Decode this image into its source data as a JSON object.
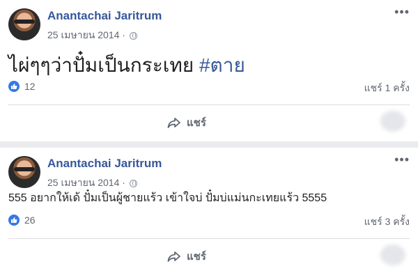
{
  "posts": [
    {
      "author": "Anantachai Jaritrum",
      "date": "25 เมษายน 2014 ·",
      "text_main": "ไผ่ๆๆว่าปั๋มเป็นกระเทย ",
      "hashtag": "#ตาย",
      "likes": "12",
      "shares": "แชร์ 1 ครั้ง",
      "share_label": "แชร์"
    },
    {
      "author": "Anantachai Jaritrum",
      "date": "25 เมษายน 2014 ·",
      "text_main": "555 อยากให้เด้ ปั๋มเป็นผู้ชายแร้ว เข้าใจบ่ ปั๋มบ่แม่นกะเทยแร้ว 5555",
      "likes": "26",
      "shares": "แชร์ 3 ครั้ง",
      "share_label": "แชร์"
    }
  ],
  "colors": {
    "link": "#365899",
    "like": "#3578e5",
    "muted": "#606770"
  },
  "icons": {
    "more": "more-dots-icon",
    "privacy": "globe-icon",
    "like": "thumbs-up-icon",
    "share": "share-arrow-icon"
  }
}
